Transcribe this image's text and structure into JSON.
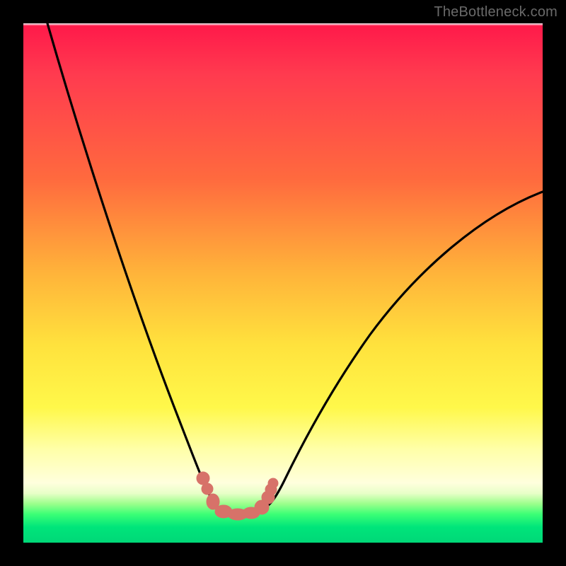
{
  "watermark": "TheBottleneck.com",
  "chart_data": {
    "type": "line",
    "title": "",
    "xlabel": "",
    "ylabel": "",
    "xlim": [
      0,
      100
    ],
    "ylim": [
      0,
      100
    ],
    "series": [
      {
        "name": "bottleneck-curve",
        "x": [
          5,
          10,
          15,
          20,
          25,
          30,
          32,
          34,
          36,
          38,
          40,
          42,
          44,
          46,
          48,
          50,
          55,
          60,
          65,
          70,
          75,
          80,
          85,
          90,
          95,
          100
        ],
        "y": [
          100,
          83,
          67,
          52,
          38,
          25,
          19,
          14,
          10,
          8,
          7.5,
          7.5,
          7.5,
          7.8,
          9,
          12,
          20,
          28,
          36,
          43,
          49,
          54,
          58,
          62,
          65,
          67
        ]
      }
    ],
    "marker_region_x": [
      32,
      47
    ],
    "gradient_stops": [
      {
        "pos": 0.0,
        "color": "#ff1a4a"
      },
      {
        "pos": 0.5,
        "color": "#ffb33a"
      },
      {
        "pos": 0.75,
        "color": "#fff84a"
      },
      {
        "pos": 0.9,
        "color": "#ffffdd"
      },
      {
        "pos": 0.95,
        "color": "#3cff76"
      },
      {
        "pos": 1.0,
        "color": "#00d878"
      }
    ]
  }
}
